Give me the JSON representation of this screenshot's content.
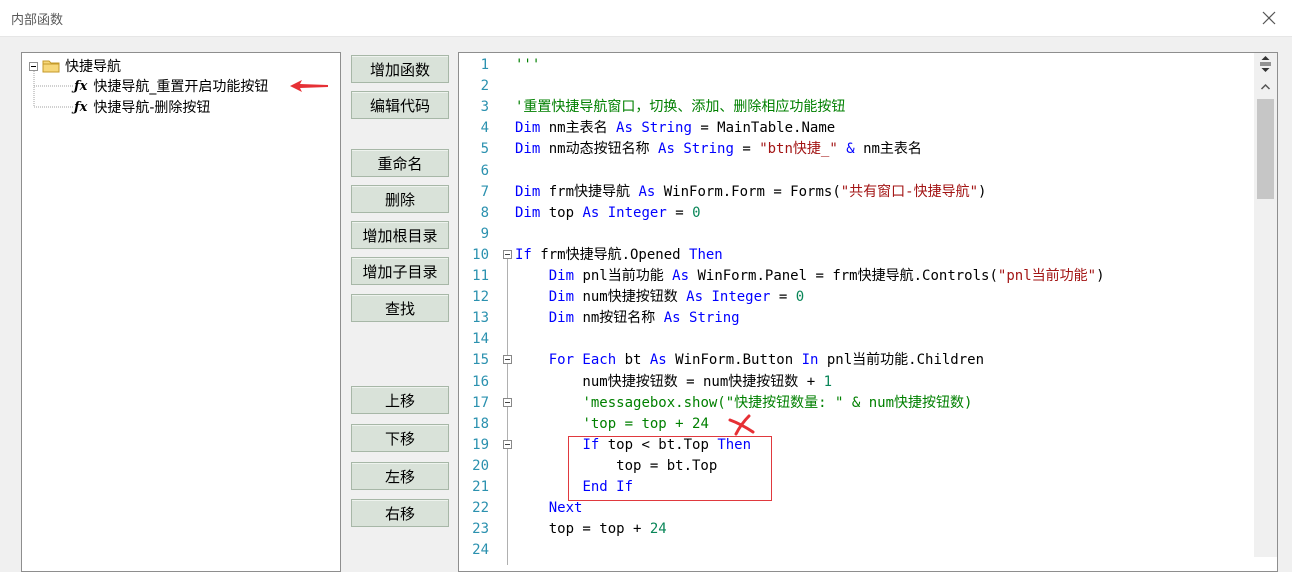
{
  "window": {
    "title": "内部函数"
  },
  "tree": {
    "root": {
      "label": "快捷导航"
    },
    "children": [
      {
        "label": "快捷导航_重置开启功能按钮",
        "icon": "fx-icon"
      },
      {
        "label": "快捷导航-删除按钮",
        "icon": "fx-icon"
      }
    ]
  },
  "buttons": {
    "add_function": "增加函数",
    "edit_code": "编辑代码",
    "rename": "重命名",
    "delete": "删除",
    "add_root": "增加根目录",
    "add_child": "增加子目录",
    "find": "查找",
    "move_up": "上移",
    "move_down": "下移",
    "move_left": "左移",
    "move_right": "右移"
  },
  "code_lines": [
    {
      "n": "1",
      "tokens": [
        [
          "cm",
          "'''"
        ]
      ]
    },
    {
      "n": "2",
      "tokens": []
    },
    {
      "n": "3",
      "tokens": [
        [
          "cm",
          "'重置快捷导航窗口，切换、添加、删除相应功能按钮"
        ]
      ]
    },
    {
      "n": "4",
      "tokens": [
        [
          "kw",
          "Dim"
        ],
        [
          "",
          " nm主表名 "
        ],
        [
          "kw",
          "As"
        ],
        [
          "",
          " "
        ],
        [
          "kw",
          "String"
        ],
        [
          "",
          " = MainTable.Name"
        ]
      ]
    },
    {
      "n": "5",
      "tokens": [
        [
          "kw",
          "Dim"
        ],
        [
          "",
          " nm动态按钮名称 "
        ],
        [
          "kw",
          "As"
        ],
        [
          "",
          " "
        ],
        [
          "kw",
          "String"
        ],
        [
          "",
          " = "
        ],
        [
          "str",
          "\"btn快捷_\""
        ],
        [
          "",
          " "
        ],
        [
          "kw",
          "&"
        ],
        [
          "",
          " nm主表名"
        ]
      ]
    },
    {
      "n": "6",
      "tokens": []
    },
    {
      "n": "7",
      "tokens": [
        [
          "kw",
          "Dim"
        ],
        [
          "",
          " frm快捷导航 "
        ],
        [
          "kw",
          "As"
        ],
        [
          "",
          " WinForm.Form = Forms("
        ],
        [
          "str",
          "\"共有窗口-快捷导航\""
        ],
        [
          "",
          ")"
        ]
      ]
    },
    {
      "n": "8",
      "tokens": [
        [
          "kw",
          "Dim"
        ],
        [
          "",
          " top "
        ],
        [
          "kw",
          "As"
        ],
        [
          "",
          " "
        ],
        [
          "kw",
          "Integer"
        ],
        [
          "",
          " = "
        ],
        [
          "num",
          "0"
        ]
      ]
    },
    {
      "n": "9",
      "tokens": []
    },
    {
      "n": "10",
      "tokens": [
        [
          "kw",
          "If"
        ],
        [
          "",
          " frm快捷导航.Opened "
        ],
        [
          "kw",
          "Then"
        ]
      ]
    },
    {
      "n": "11",
      "tokens": [
        [
          "",
          "    "
        ],
        [
          "kw",
          "Dim"
        ],
        [
          "",
          " pnl当前功能 "
        ],
        [
          "kw",
          "As"
        ],
        [
          "",
          " WinForm.Panel = frm快捷导航.Controls("
        ],
        [
          "str",
          "\"pnl当前功能\""
        ],
        [
          "",
          ")"
        ]
      ]
    },
    {
      "n": "12",
      "tokens": [
        [
          "",
          "    "
        ],
        [
          "kw",
          "Dim"
        ],
        [
          "",
          " num快捷按钮数 "
        ],
        [
          "kw",
          "As"
        ],
        [
          "",
          " "
        ],
        [
          "kw",
          "Integer"
        ],
        [
          "",
          " = "
        ],
        [
          "num",
          "0"
        ]
      ]
    },
    {
      "n": "13",
      "tokens": [
        [
          "",
          "    "
        ],
        [
          "kw",
          "Dim"
        ],
        [
          "",
          " nm按钮名称 "
        ],
        [
          "kw",
          "As"
        ],
        [
          "",
          " "
        ],
        [
          "kw",
          "String"
        ]
      ]
    },
    {
      "n": "14",
      "tokens": []
    },
    {
      "n": "15",
      "tokens": [
        [
          "",
          "    "
        ],
        [
          "kw",
          "For Each"
        ],
        [
          "",
          " bt "
        ],
        [
          "kw",
          "As"
        ],
        [
          "",
          " WinForm.Button "
        ],
        [
          "kw",
          "In"
        ],
        [
          "",
          " pnl当前功能.Children"
        ]
      ]
    },
    {
      "n": "16",
      "tokens": [
        [
          "",
          "        num快捷按钮数 = num快捷按钮数 + "
        ],
        [
          "num",
          "1"
        ]
      ]
    },
    {
      "n": "17",
      "tokens": [
        [
          "",
          "        "
        ],
        [
          "cm",
          "'messagebox.show(\"快捷按钮数量: \" & num快捷按钮数)"
        ]
      ]
    },
    {
      "n": "18",
      "tokens": [
        [
          "",
          "        "
        ],
        [
          "cm",
          "'top = top + 24"
        ]
      ]
    },
    {
      "n": "19",
      "tokens": [
        [
          "",
          "        "
        ],
        [
          "kw",
          "If"
        ],
        [
          "",
          " top < bt.Top "
        ],
        [
          "kw",
          "Then"
        ]
      ]
    },
    {
      "n": "20",
      "tokens": [
        [
          "",
          "            top = bt.Top"
        ]
      ]
    },
    {
      "n": "21",
      "tokens": [
        [
          "",
          "        "
        ],
        [
          "kw",
          "End If"
        ]
      ]
    },
    {
      "n": "22",
      "tokens": [
        [
          "",
          "    "
        ],
        [
          "kw",
          "Next"
        ]
      ]
    },
    {
      "n": "23",
      "tokens": [
        [
          "",
          "    top = top + "
        ],
        [
          "num",
          "24"
        ]
      ]
    },
    {
      "n": "24",
      "tokens": []
    }
  ]
}
